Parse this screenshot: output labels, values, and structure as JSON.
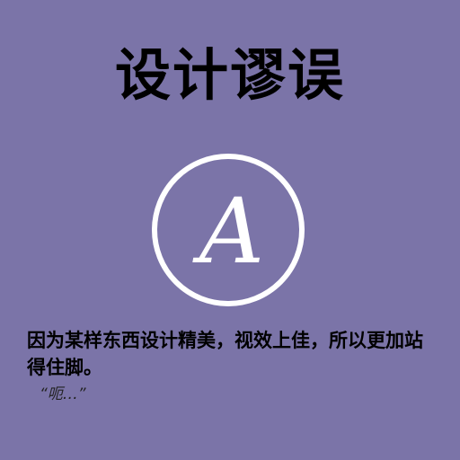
{
  "title": "设计谬误",
  "logo": {
    "icon": "script-letter-a-circle-logo",
    "letter": "A"
  },
  "body_text": "因为某样东西设计精美，视效上佳，所以更加站得住脚。",
  "quote": "“呃…”",
  "colors": {
    "background": "#7b74a8",
    "logo": "#ffffff",
    "text": "#000000"
  }
}
